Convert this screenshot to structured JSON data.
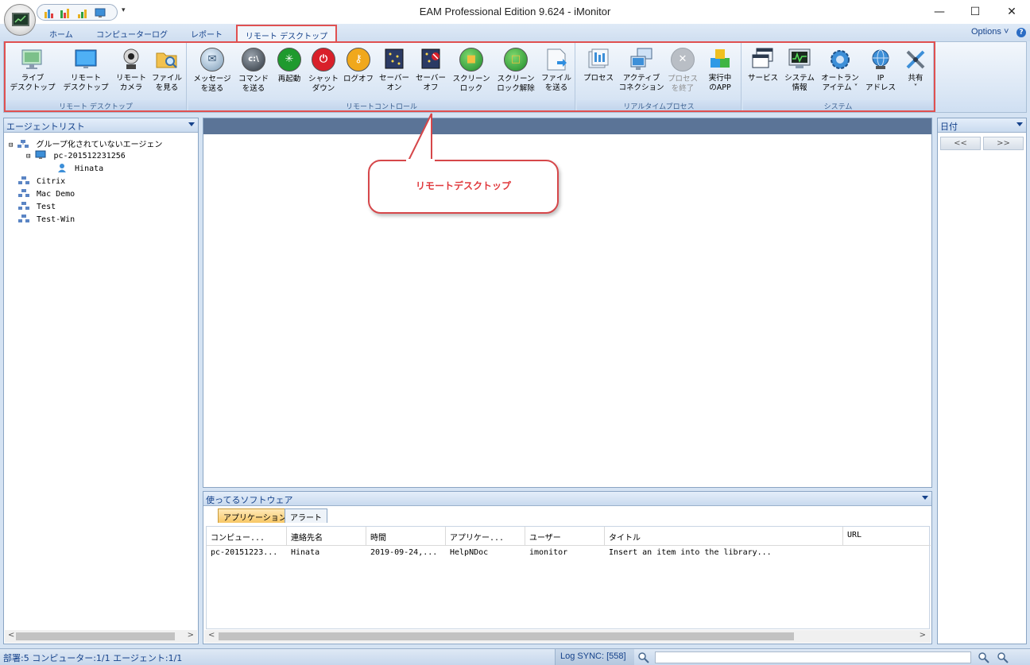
{
  "window": {
    "title": "EAM Professional Edition 9.624 - iMonitor",
    "minimize": "—",
    "maximize": "☐",
    "close": "✕",
    "qat_more": "▾"
  },
  "tabs": {
    "home": "ホーム",
    "computer_log": "コンピューターログ",
    "report": "レポート",
    "remote_desktop": "リモート デスクトップ",
    "options": "Options ˅",
    "help": "?"
  },
  "ribbon": {
    "groups": {
      "remote_desktop": "リモート デスクトップ",
      "remote_control": "リモートコントロール",
      "realtime_process": "リアルタイムプロセス",
      "system": "システム"
    },
    "buttons": {
      "live_desktop": [
        "ライブ",
        "デスクトップ"
      ],
      "remote_desktop": [
        "リモート",
        "デスクトップ"
      ],
      "remote_camera": [
        "リモート",
        "カメラ"
      ],
      "view_files": [
        "ファイル",
        "を見る"
      ],
      "send_message": [
        "メッセージ",
        "を送る"
      ],
      "send_command": [
        "コマンド",
        "を送る"
      ],
      "restart": [
        "再起動",
        ""
      ],
      "shutdown": [
        "シャット",
        "ダウン"
      ],
      "logoff": [
        "ログオフ",
        ""
      ],
      "saver_on": [
        "セーバー",
        "オン"
      ],
      "saver_off": [
        "セーバー",
        "オフ"
      ],
      "screen_lock": [
        "スクリーン",
        "ロック"
      ],
      "screen_unlock": [
        "スクリーン",
        "ロック解除"
      ],
      "send_file": [
        "ファイル",
        "を送る"
      ],
      "process": [
        "プロセス",
        ""
      ],
      "active_connection": [
        "アクティブ",
        "コネクション"
      ],
      "end_process": [
        "プロセス",
        "を終了"
      ],
      "running_app": [
        "実行中",
        "のAPP"
      ],
      "service": [
        "サービス",
        ""
      ],
      "system_info": [
        "システム",
        "情報"
      ],
      "autorun": [
        "オートラン",
        "アイテム ˅"
      ],
      "ip_address": [
        "IP",
        "アドレス"
      ],
      "share": [
        "共有",
        "˅"
      ]
    },
    "colors": {
      "highlight": "#e05050",
      "restart": "#1f9a2e",
      "shutdown": "#d9202a",
      "logoff": "#f0a81c"
    }
  },
  "agent_list": {
    "header": "エージェントリスト",
    "items": [
      {
        "label": "グループ化されていないエージェン",
        "icon": "group-icon"
      },
      {
        "label": "pc-201512231256",
        "icon": "computer-icon"
      },
      {
        "label": "Hinata",
        "icon": "user-icon"
      },
      {
        "label": "Citrix",
        "icon": "group-icon"
      },
      {
        "label": "Mac Demo",
        "icon": "group-icon"
      },
      {
        "label": "Test",
        "icon": "group-icon"
      },
      {
        "label": "Test-Win",
        "icon": "group-icon"
      }
    ],
    "expander_1": "⊟",
    "expander_2": "⊟"
  },
  "callout": {
    "text": "リモートデスクトップ",
    "color": "#e03a3e"
  },
  "date_pane": {
    "header": "日付",
    "prev": "<<",
    "next": ">>"
  },
  "software_pane": {
    "header": "使ってるソフトウェア",
    "tabs": [
      "アプリケーション",
      "アラート"
    ],
    "columns": [
      "コンピュー...",
      "連絡先名",
      "時間",
      "アプリケー...",
      "ユーザー",
      "タイトル",
      "URL"
    ],
    "rows": [
      [
        "pc-20151223...",
        "Hinata",
        "2019-09-24,...",
        "HelpNDoc",
        "imonitor",
        "Insert an item into the library...",
        ""
      ]
    ]
  },
  "scroll": {
    "left": "<",
    "right": ">"
  },
  "status": {
    "left": "部署:5  コンピューター:1/1  エージェント:1/1",
    "log_sync": "Log SYNC: [558]"
  }
}
